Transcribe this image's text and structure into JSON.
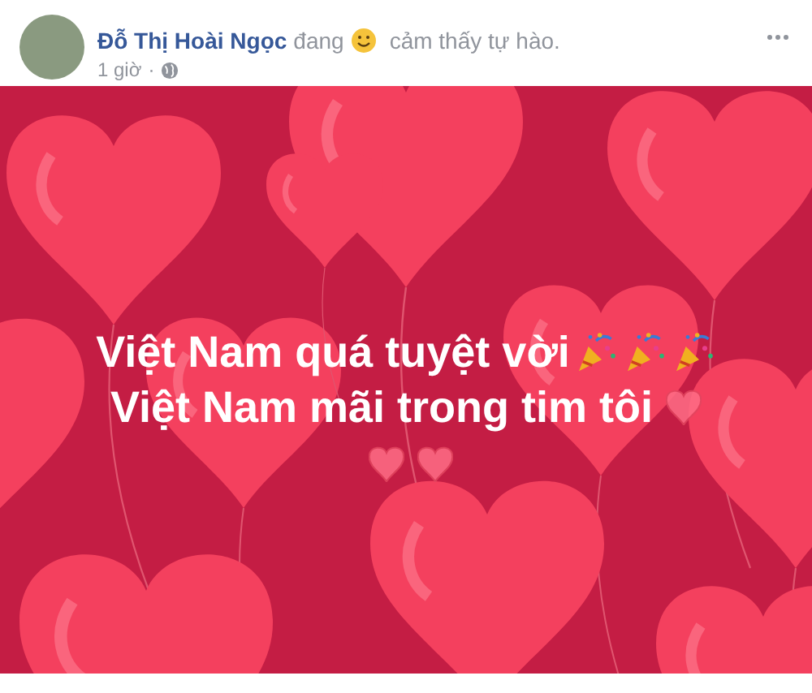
{
  "post": {
    "author": "Đỗ Thị Hoài Ngọc",
    "status_prefix": "đang",
    "feeling": "cảm thấy tự hào.",
    "time": "1 giờ",
    "separator": "·"
  },
  "card": {
    "lines": [
      "Việt Nam quá tuyệt vời",
      "Việt Nam mãi trong tim tôi"
    ]
  }
}
